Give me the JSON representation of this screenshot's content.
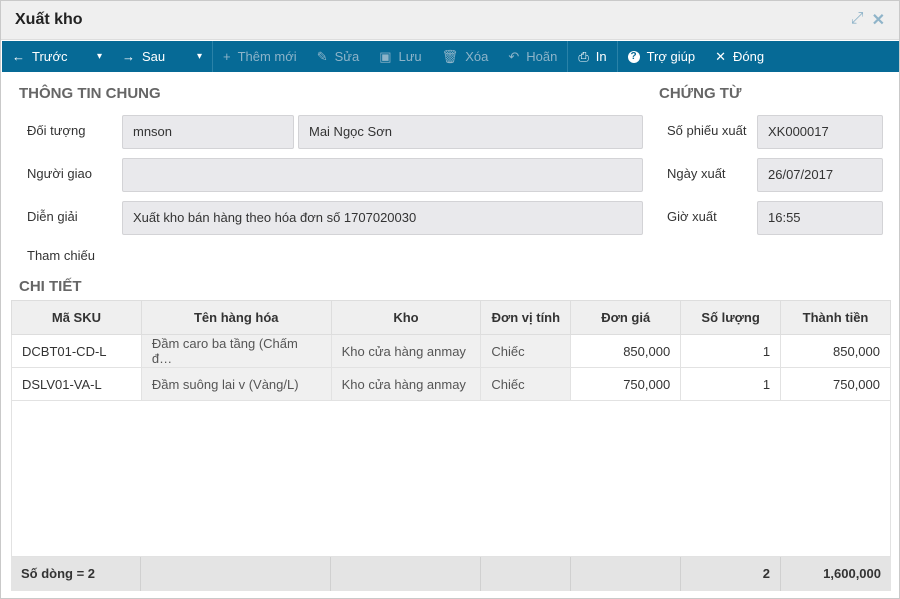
{
  "window": {
    "title": "Xuất kho"
  },
  "toolbar": [
    {
      "label": "Trước",
      "icon": "arrow-left-icon",
      "caret": true,
      "enabled": true
    },
    {
      "label": "Sau",
      "icon": "arrow-right-icon",
      "caret": true,
      "enabled": true
    },
    {
      "label": "Thêm mới",
      "icon": "plus-icon",
      "enabled": false
    },
    {
      "label": "Sửa",
      "icon": "pencil-icon",
      "enabled": false
    },
    {
      "label": "Lưu",
      "icon": "save-icon",
      "enabled": false
    },
    {
      "label": "Xóa",
      "icon": "trash-icon",
      "enabled": false
    },
    {
      "label": "Hoãn",
      "icon": "undo-icon",
      "enabled": false
    },
    {
      "label": "In",
      "icon": "print-icon",
      "enabled": true
    },
    {
      "label": "Trợ giúp",
      "icon": "help-icon",
      "enabled": true
    },
    {
      "label": "Đóng",
      "icon": "close-icon",
      "enabled": true
    }
  ],
  "general": {
    "heading": "THÔNG TIN CHUNG",
    "doi_tuong_label": "Đối tượng",
    "doi_tuong_code": "mnson",
    "doi_tuong_name": "Mai Ngọc Sơn",
    "nguoi_giao_label": "Người giao",
    "nguoi_giao": "",
    "dien_giai_label": "Diễn giải",
    "dien_giai": "Xuất kho bán hàng theo hóa đơn số 1707020030",
    "tham_chieu_label": "Tham chiếu"
  },
  "voucher": {
    "heading": "CHỨNG TỪ",
    "so_phieu_label": "Số phiếu xuất",
    "so_phieu": "XK000017",
    "ngay_label": "Ngày xuất",
    "ngay": "26/07/2017",
    "gio_label": "Giờ xuất",
    "gio": "16:55"
  },
  "detail": {
    "heading": "CHI TIẾT",
    "columns": [
      "Mã SKU",
      "Tên hàng hóa",
      "Kho",
      "Đơn vị tính",
      "Đơn giá",
      "Số lượng",
      "Thành tiền"
    ],
    "rows": [
      [
        "DCBT01-CD-L",
        "Đầm caro ba tầng (Chấm đ…",
        "Kho cửa hàng anmay",
        "Chiếc",
        "850,000",
        "1",
        "850,000"
      ],
      [
        "DSLV01-VA-L",
        "Đầm suông lai v (Vàng/L)",
        "Kho cửa hàng anmay",
        "Chiếc",
        "750,000",
        "1",
        "750,000"
      ]
    ],
    "footer": {
      "row_count": "Số dòng = 2",
      "total_qty": "2",
      "total_amount": "1,600,000"
    }
  }
}
